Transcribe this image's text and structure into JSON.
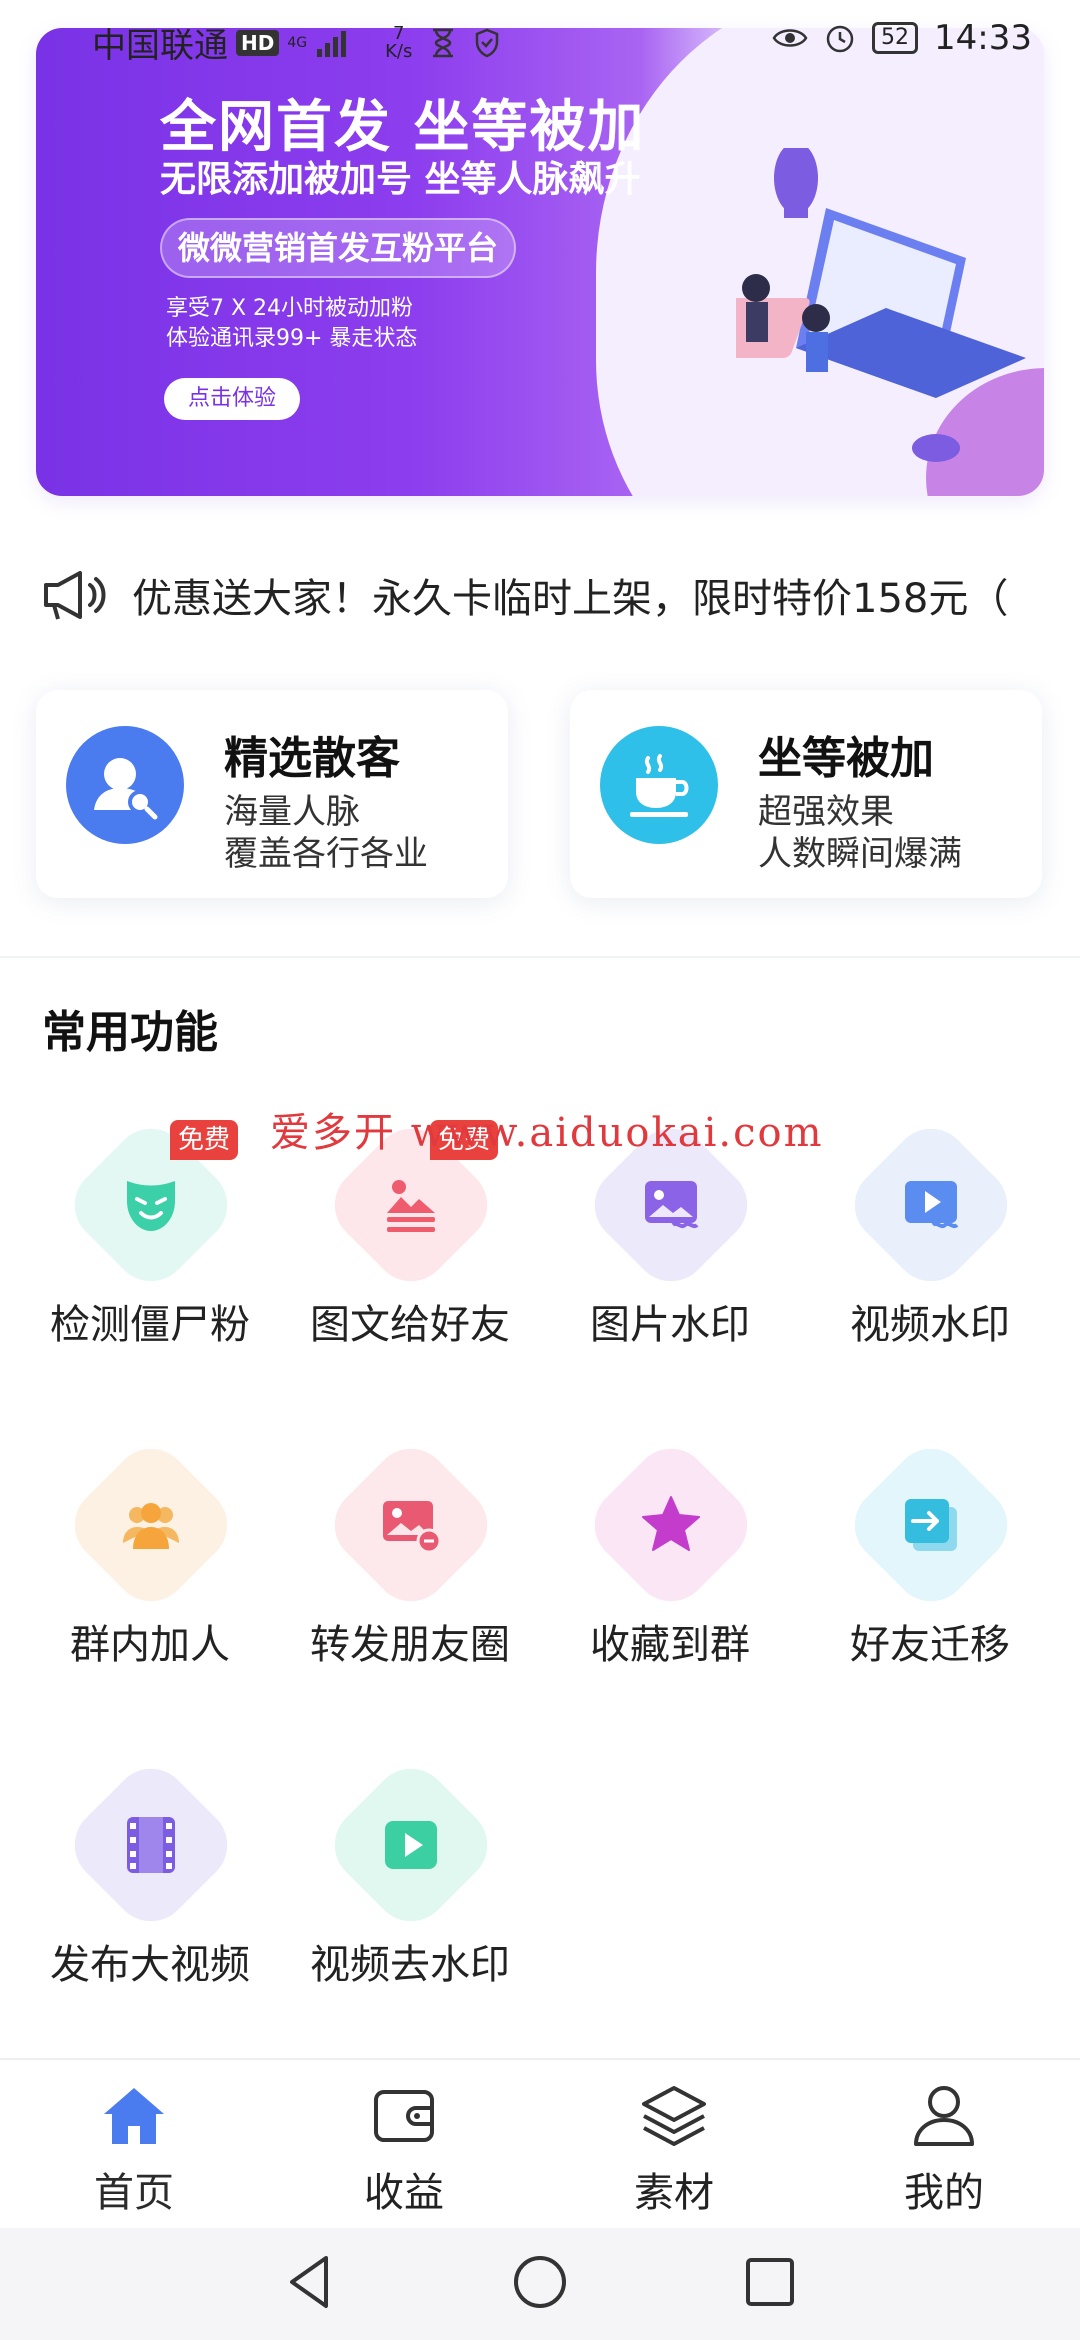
{
  "status_bar": {
    "carrier": "中国联通",
    "hd": "HD",
    "network": "4G",
    "speed_value": "7",
    "speed_unit": "K/s",
    "battery": "52",
    "time": "14:33"
  },
  "banner": {
    "title": "全网首发 坐等被加",
    "subtitle": "无限添加被加号 坐等人脉飙升",
    "pill": "微微营销首发互粉平台",
    "desc1": "享受7 X 24小时被动加粉",
    "desc2": "体验通讯录99+ 暴走状态",
    "cta": "点击体验"
  },
  "notice": {
    "icon": "megaphone-icon",
    "text": "优惠送大家！永久卡临时上架，限时特价158元（"
  },
  "cards": [
    {
      "title": "精选散客",
      "line1": "海量人脉",
      "line2": "覆盖各行各业",
      "icon": "user-search-icon",
      "color": "#4a7cf0"
    },
    {
      "title": "坐等被加",
      "line1": "超强效果",
      "line2": "人数瞬间爆满",
      "icon": "coffee-cup-icon",
      "color": "#2ec0e8"
    }
  ],
  "section_title": "常用功能",
  "watermark": "爱多开 www.aiduokai.com",
  "free_badge": "免费",
  "grid": [
    {
      "label": "检测僵尸粉",
      "icon": "mask-icon",
      "bg": "#e3f8f3",
      "fg": "#3cd0a8",
      "badge": true
    },
    {
      "label": "图文给好友",
      "icon": "image-text-icon",
      "bg": "#fde7ea",
      "fg": "#ee5c6d",
      "badge": true
    },
    {
      "label": "图片水印",
      "icon": "image-watermark-icon",
      "bg": "#ece9fb",
      "fg": "#8b63e6",
      "badge": false
    },
    {
      "label": "视频水印",
      "icon": "video-watermark-icon",
      "bg": "#e9f0fc",
      "fg": "#5b8df0",
      "badge": false
    },
    {
      "label": "群内加人",
      "icon": "group-icon",
      "bg": "#fdf1e3",
      "fg": "#f5a53c",
      "badge": false
    },
    {
      "label": "转发朋友圈",
      "icon": "forward-moments-icon",
      "bg": "#fde8ec",
      "fg": "#e95a72",
      "badge": false
    },
    {
      "label": "收藏到群",
      "icon": "star-icon",
      "bg": "#fbe6f6",
      "fg": "#c43ccb",
      "badge": false
    },
    {
      "label": "好友迁移",
      "icon": "transfer-icon",
      "bg": "#e3f6fb",
      "fg": "#35bde0",
      "badge": false
    },
    {
      "label": "发布大视频",
      "icon": "film-icon",
      "bg": "#ece9fb",
      "fg": "#7c5ce0",
      "badge": false
    },
    {
      "label": "视频去水印",
      "icon": "play-icon",
      "bg": "#e1f8f1",
      "fg": "#3ccfa2",
      "badge": false
    }
  ],
  "nav": [
    {
      "label": "首页",
      "icon": "home-icon",
      "active": true
    },
    {
      "label": "收益",
      "icon": "wallet-icon",
      "active": false
    },
    {
      "label": "素材",
      "icon": "layers-icon",
      "active": false
    },
    {
      "label": "我的",
      "icon": "profile-icon",
      "active": false
    }
  ],
  "accent": "#4a7cf0"
}
